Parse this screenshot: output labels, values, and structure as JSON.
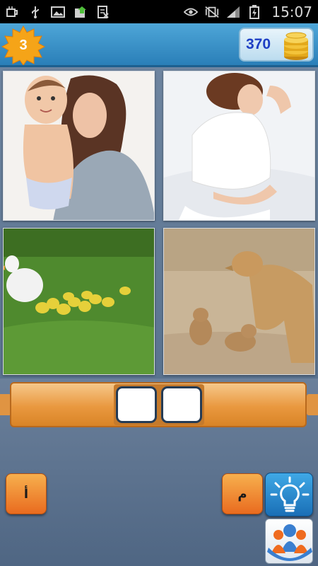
{
  "status_bar": {
    "time": "15:07",
    "left_icons": [
      "coffee-cup-icon",
      "usb-icon",
      "image-icon",
      "download-icon",
      "document-icon"
    ],
    "right_icons": [
      "eye-icon",
      "vibrate-silent-icon",
      "signal-icon",
      "battery-charging-icon"
    ]
  },
  "header": {
    "level": "3",
    "coins": "370"
  },
  "photos": [
    {
      "label": "mother-holding-baby"
    },
    {
      "label": "pregnant-woman"
    },
    {
      "label": "duck-with-ducklings"
    },
    {
      "label": "lioness-with-cubs"
    }
  ],
  "answer": {
    "slots": [
      "",
      ""
    ]
  },
  "letters": {
    "left": "أ",
    "right": "م"
  },
  "colors": {
    "header_blue": "#2a7fb8",
    "coin_text": "#1e3fc4",
    "tile_orange": "#e96b1f",
    "answer_bar": "#e9983f"
  }
}
